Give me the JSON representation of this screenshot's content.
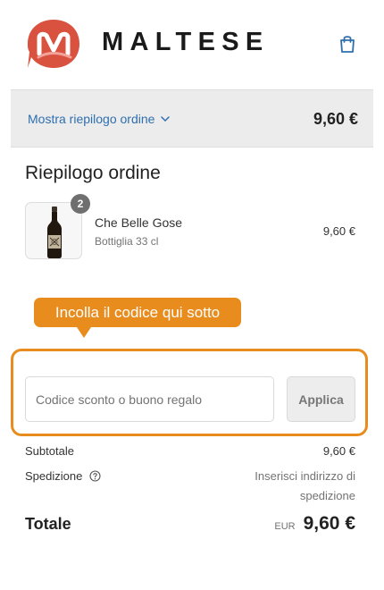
{
  "header": {
    "brand": "MALTESE",
    "logo_icon": "maltese-m-logo",
    "cart_icon": "shopping-bag-icon",
    "colors": {
      "logo": "#d9513f",
      "brand_text": "#1a1a1a",
      "link": "#2f6fae"
    }
  },
  "summary_bar": {
    "toggle_label": "Mostra riepilogo ordine",
    "toggle_icon": "chevron-down-icon",
    "total": "9,60 €"
  },
  "order": {
    "title": "Riepilogo ordine",
    "items": [
      {
        "name": "Che Belle Gose",
        "variant": "Bottiglia 33 cl",
        "price": "9,60 €",
        "quantity": "2"
      }
    ]
  },
  "coupon": {
    "callout": "Incolla il codice qui sotto",
    "placeholder": "Codice sconto o buono regalo",
    "apply_label": "Applica",
    "accent_color": "#e98c1e"
  },
  "totals": {
    "subtotal_label": "Subtotale",
    "subtotal_value": "9,60 €",
    "shipping_label": "Spedizione",
    "shipping_value": "Inserisci indirizzo di spedizione",
    "total_label": "Totale",
    "currency": "EUR",
    "total_value": "9,60 €"
  }
}
